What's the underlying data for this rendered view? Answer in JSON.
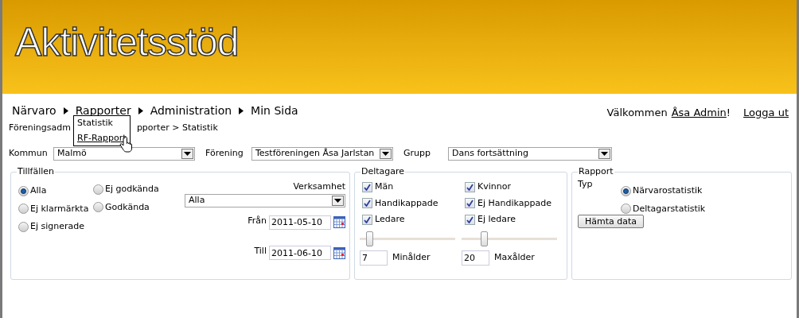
{
  "header": {
    "logo": "Aktivitetsstöd"
  },
  "menu": [
    {
      "label": "Närvaro"
    },
    {
      "label": "Rapporter"
    },
    {
      "label": "Administration"
    },
    {
      "label": "Min Sida"
    }
  ],
  "submenu": [
    {
      "label": "Statistik",
      "hovered": false
    },
    {
      "label": "RF-Rapport",
      "hovered": true
    }
  ],
  "breadcrumb": [
    "Föreningsadm",
    "pporter > Statistik"
  ],
  "user": {
    "greeting": "Välkommen",
    "name": "Åsa Admin",
    "after": "!",
    "logout": "Logga ut"
  },
  "filters": [
    {
      "label": "Kommun",
      "value": "Malmö"
    },
    {
      "label": "Förening",
      "value": "Testföreningen Åsa Jarlstan"
    },
    {
      "label": "Grupp",
      "value": "Dans fortsättning"
    }
  ],
  "tillfallen": {
    "title": "Tillfällen",
    "options": [
      {
        "label": "Alla",
        "selected": true
      },
      {
        "label": "Ej godkända",
        "selected": false
      },
      {
        "label": "Ej klarmärkta",
        "selected": false
      },
      {
        "label": "Godkända",
        "selected": false
      },
      {
        "label": "Ej signerade",
        "selected": false
      }
    ],
    "verksamhet_label": "Verksamhet",
    "verksamhet": "Alla",
    "from_label": "Från",
    "from": "2011-05-10",
    "to_label": "Till",
    "to": "2011-06-10"
  },
  "deltagare": {
    "title": "Deltagare",
    "checks": [
      {
        "label": "Män",
        "checked": true
      },
      {
        "label": "Kvinnor",
        "checked": true
      },
      {
        "label": "Handikappade",
        "checked": true
      },
      {
        "label": "Ej Handikappade",
        "checked": true
      },
      {
        "label": "Ledare",
        "checked": true
      },
      {
        "label": "Ej ledare",
        "checked": true
      }
    ],
    "ages": [
      {
        "level": 0.1,
        "value": "7",
        "label": "Minålder"
      },
      {
        "level": 0.23,
        "value": "20",
        "label": "Maxålder"
      }
    ]
  },
  "rapport": {
    "title": "Rapport",
    "type_label": "Typ",
    "options": [
      {
        "label": "Närvarostatistik",
        "selected": true
      },
      {
        "label": "Deltagarstatistik",
        "selected": false
      }
    ],
    "button": "Hämta data"
  }
}
